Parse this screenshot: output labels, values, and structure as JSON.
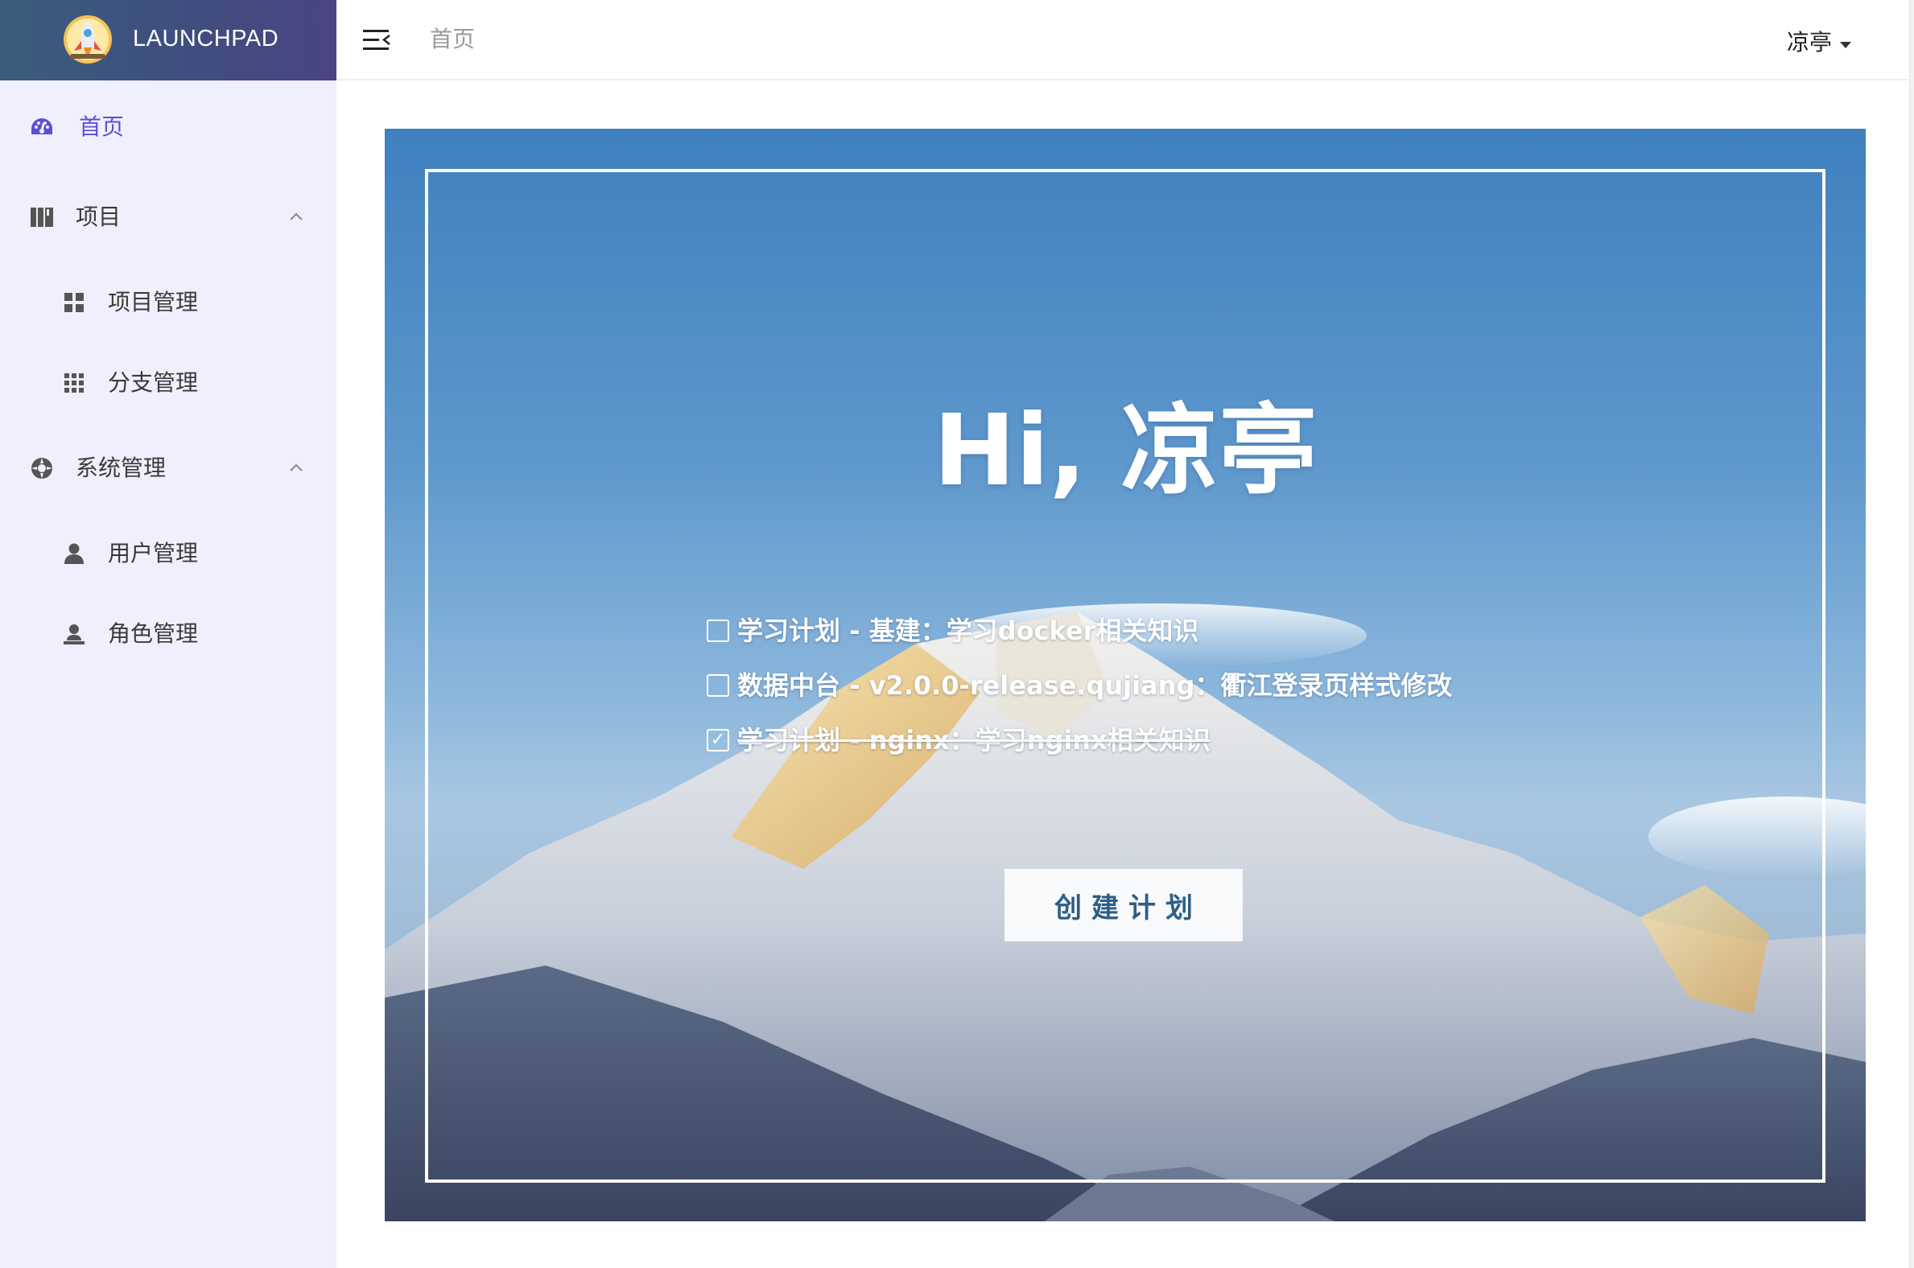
{
  "brand": {
    "name": "LAUNCHPAD",
    "logo_icon": "rocket-icon"
  },
  "sidebar": {
    "items": [
      {
        "label": "首页",
        "icon": "dashboard-icon",
        "active": true
      },
      {
        "label": "项目",
        "icon": "book-icon",
        "expanded": true,
        "children": [
          {
            "label": "项目管理",
            "icon": "grid-icon"
          },
          {
            "label": "分支管理",
            "icon": "apps-icon"
          }
        ]
      },
      {
        "label": "系统管理",
        "icon": "gear-wheel-icon",
        "expanded": true,
        "children": [
          {
            "label": "用户管理",
            "icon": "user-icon"
          },
          {
            "label": "角色管理",
            "icon": "user-role-icon"
          }
        ]
      }
    ]
  },
  "header": {
    "breadcrumb": "首页",
    "user_name": "凉亭"
  },
  "hero": {
    "greeting": "Hi, 凉亭",
    "todos": [
      {
        "text": "学习计划 - 基建：学习docker相关知识",
        "done": false
      },
      {
        "text": "数据中台 - v2.0.0-release.qujiang：衢江登录页样式修改",
        "done": false
      },
      {
        "text": "学习计划 - nginx：学习nginx相关知识",
        "done": true
      }
    ],
    "create_button": "创建计划"
  },
  "colors": {
    "sidebar_bg": "#f0effd",
    "active_menu": "#5b4fd8",
    "button_text": "#2c5f86"
  }
}
